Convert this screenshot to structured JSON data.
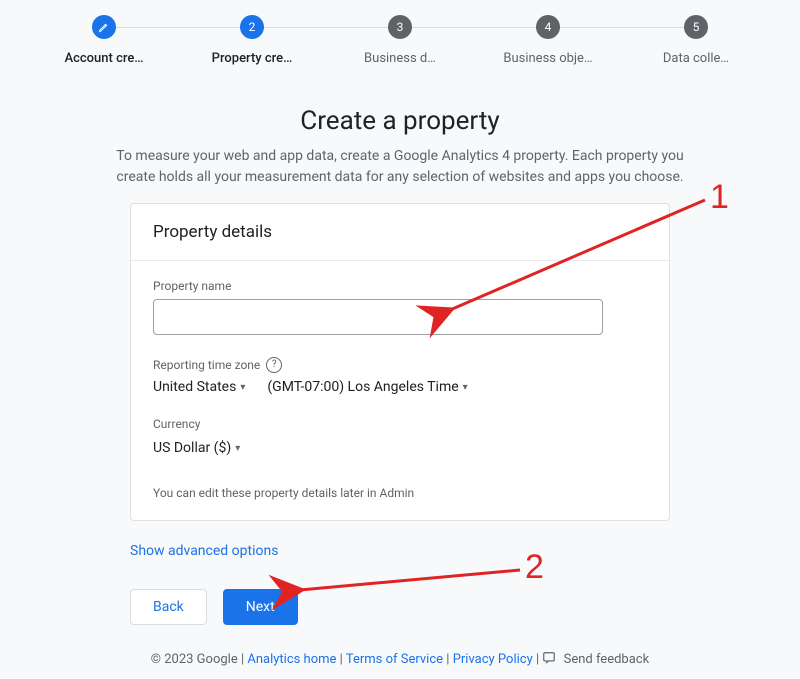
{
  "stepper": {
    "steps": [
      {
        "num": "",
        "label": "Account cre…",
        "state": "done"
      },
      {
        "num": "2",
        "label": "Property cre…",
        "state": "active"
      },
      {
        "num": "3",
        "label": "Business d…",
        "state": "pending"
      },
      {
        "num": "4",
        "label": "Business obje…",
        "state": "pending"
      },
      {
        "num": "5",
        "label": "Data colle…",
        "state": "pending"
      }
    ]
  },
  "page": {
    "title": "Create a property",
    "intro": "To measure your web and app data, create a Google Analytics 4 property. Each property you create holds all your measurement data for any selection of websites and apps you choose."
  },
  "card": {
    "header": "Property details",
    "property_name_label": "Property name",
    "property_name_value": "",
    "time_zone_label": "Reporting time zone",
    "time_zone_country": "United States",
    "time_zone_value": "(GMT-07:00) Los Angeles Time",
    "currency_label": "Currency",
    "currency_value": "US Dollar ($)",
    "note": "You can edit these property details later in Admin"
  },
  "advanced_link": "Show advanced options",
  "buttons": {
    "back": "Back",
    "next": "Next"
  },
  "footer": {
    "copyright": "© 2023 Google",
    "links": {
      "home": "Analytics home",
      "tos": "Terms of Service",
      "privacy": "Privacy Policy"
    },
    "feedback": "Send feedback"
  },
  "annotations": {
    "one": "1",
    "two": "2"
  }
}
